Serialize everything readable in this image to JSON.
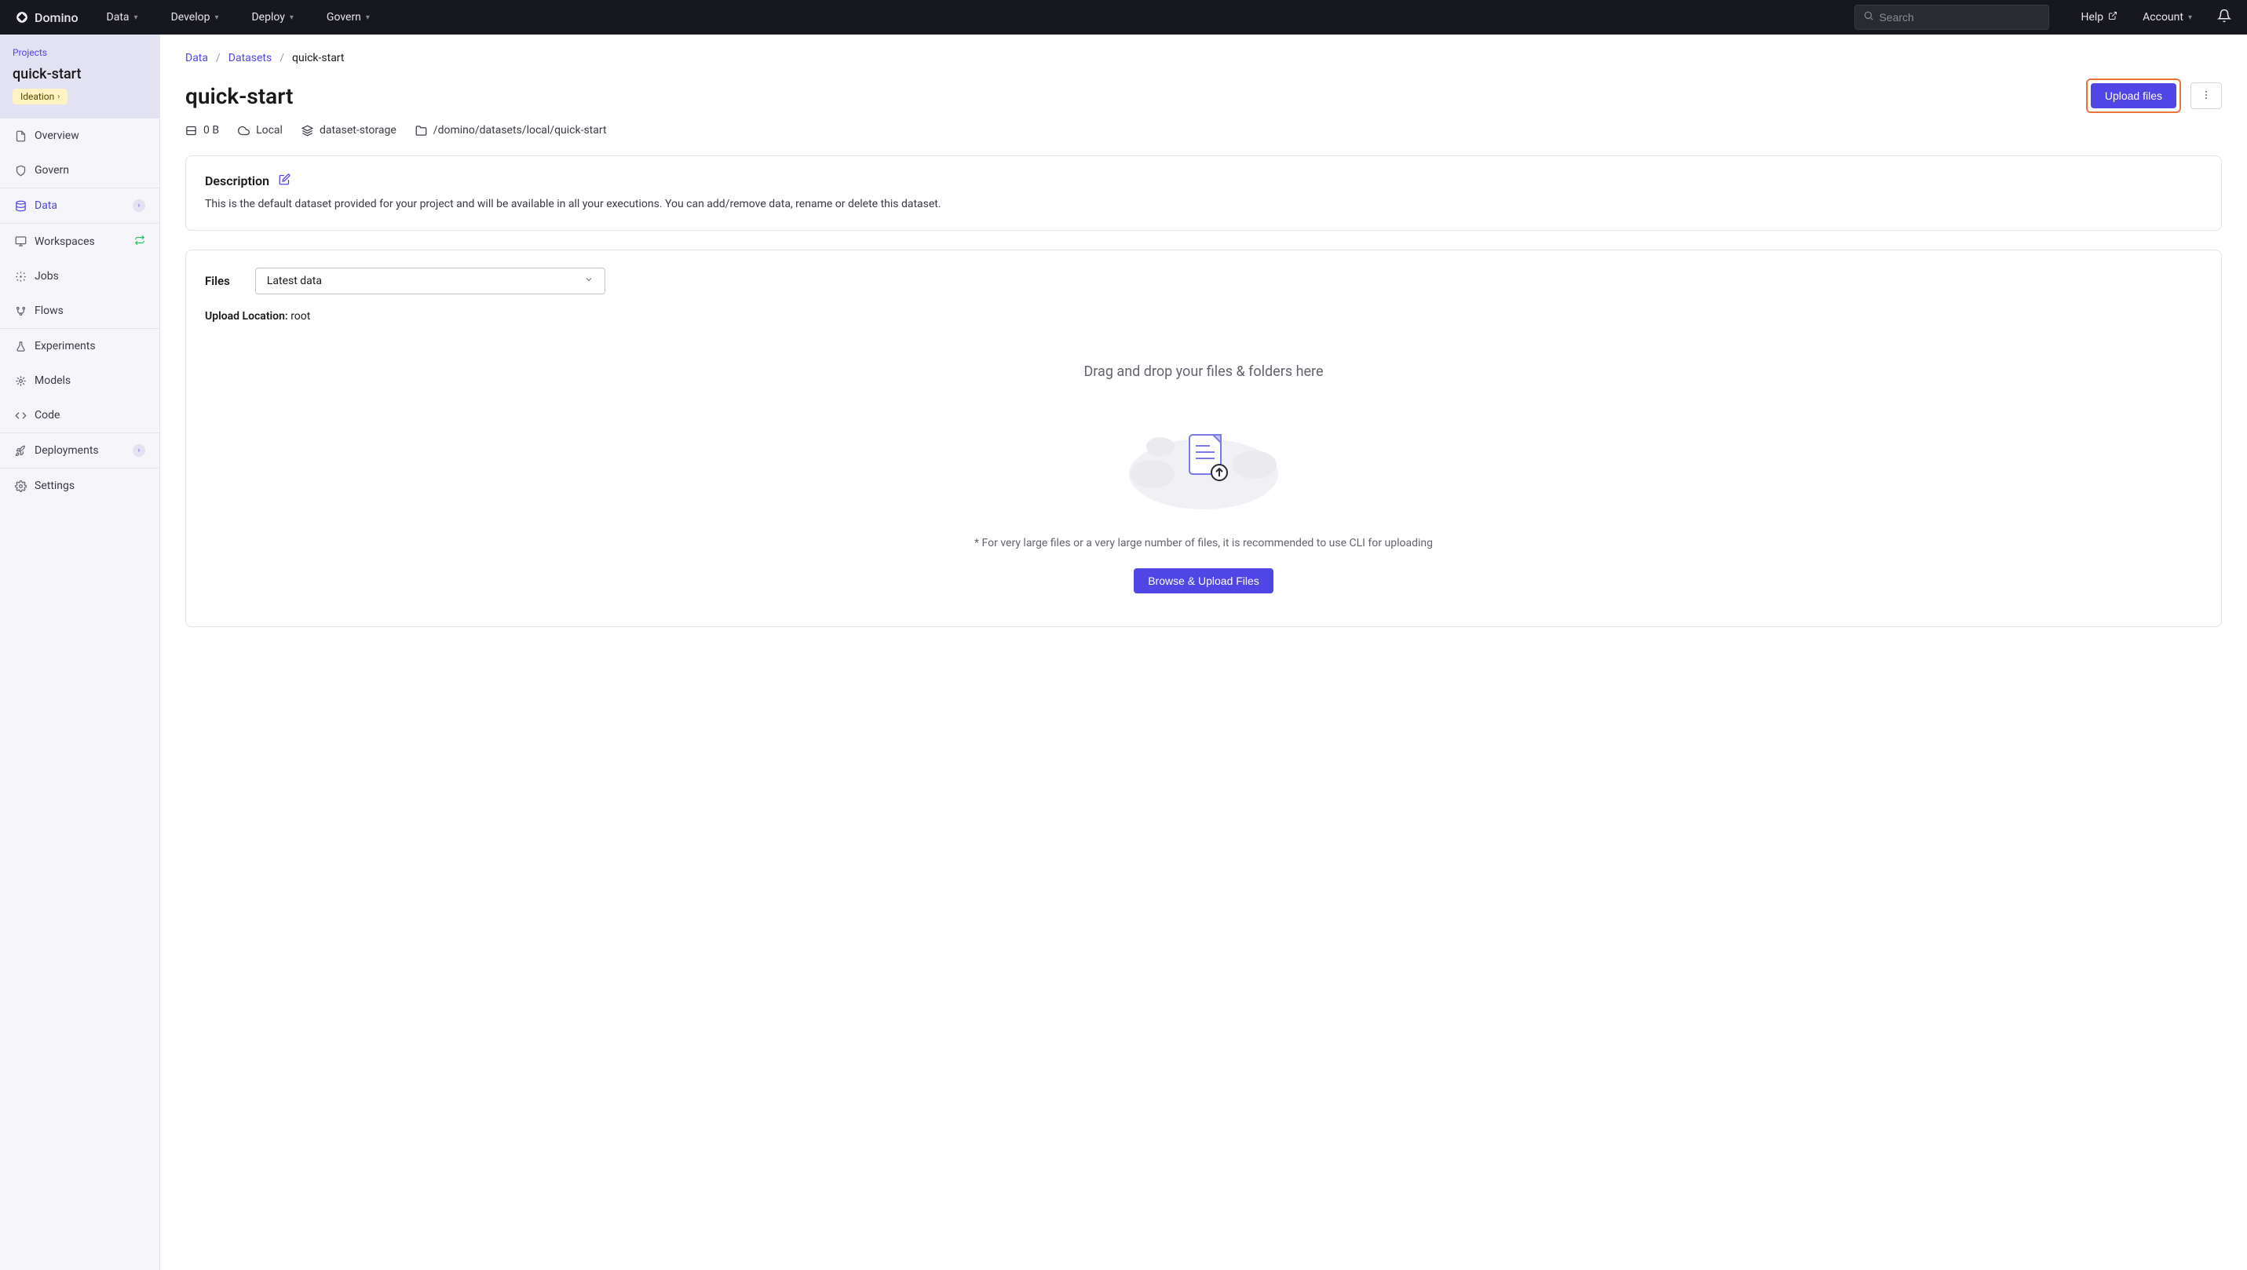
{
  "brand": "Domino",
  "topNav": {
    "items": [
      "Data",
      "Develop",
      "Deploy",
      "Govern"
    ],
    "searchPlaceholder": "Search",
    "help": "Help",
    "account": "Account"
  },
  "sidebar": {
    "projectsLabel": "Projects",
    "projectName": "quick-start",
    "stageBadge": "Ideation",
    "items": [
      {
        "label": "Overview",
        "icon": "file"
      },
      {
        "label": "Govern",
        "icon": "shield"
      },
      {
        "label": "Data",
        "icon": "database",
        "active": true,
        "chevron": true
      },
      {
        "label": "Workspaces",
        "icon": "monitor",
        "sync": true
      },
      {
        "label": "Jobs",
        "icon": "sparkle"
      },
      {
        "label": "Flows",
        "icon": "branch"
      },
      {
        "label": "Experiments",
        "icon": "flask"
      },
      {
        "label": "Models",
        "icon": "ai"
      },
      {
        "label": "Code",
        "icon": "code"
      },
      {
        "label": "Deployments",
        "icon": "rocket",
        "chevron": true
      },
      {
        "label": "Settings",
        "icon": "gear"
      }
    ]
  },
  "breadcrumb": {
    "items": [
      "Data",
      "Datasets"
    ],
    "current": "quick-start"
  },
  "page": {
    "title": "quick-start",
    "uploadBtn": "Upload files",
    "meta": {
      "size": "0 B",
      "location": "Local",
      "storage": "dataset-storage",
      "path": "/domino/datasets/local/quick-start"
    },
    "description": {
      "heading": "Description",
      "text": "This is the default dataset provided for your project and will be available in all your executions. You can add/remove data, rename or delete this dataset."
    },
    "files": {
      "label": "Files",
      "selectValue": "Latest data",
      "uploadLocationLabel": "Upload Location:",
      "uploadLocationValue": "root",
      "dropTitle": "Drag and drop your files & folders here",
      "dropHint": "* For very large files or a very large number of files, it is recommended to use CLI for uploading",
      "browseBtn": "Browse & Upload Files"
    }
  }
}
